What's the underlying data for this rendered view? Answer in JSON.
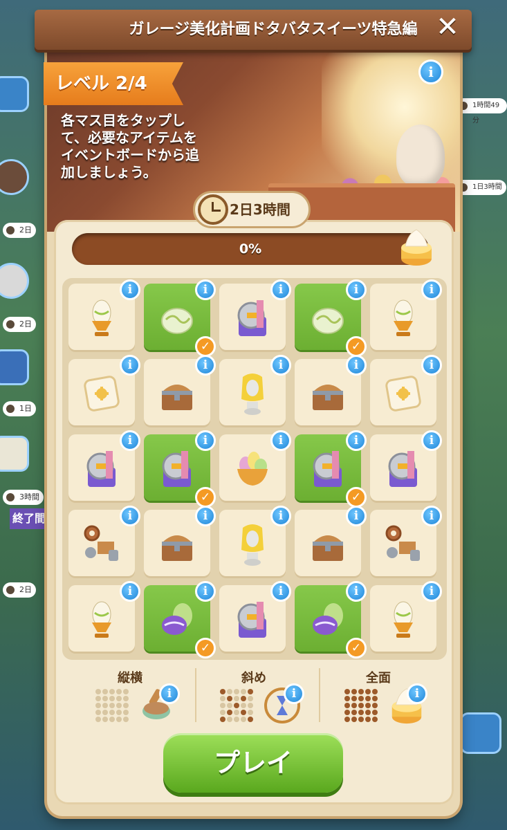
{
  "header": {
    "title": "ガレージ美化計画ドタバタスイーツ特急編",
    "close_icon": "close-icon"
  },
  "level": {
    "label": "レベル 2/4"
  },
  "instructions": "各マス目をタップし\nて、必要なアイテムを\nイベントボードから追\n加しましょう。",
  "timer": {
    "text": "2日3時間",
    "icon": "clock-icon"
  },
  "progress": {
    "text": "0%",
    "value": 0
  },
  "board": {
    "rows": [
      [
        {
          "item": "egg-cup",
          "done": false
        },
        {
          "item": "egg",
          "done": true
        },
        {
          "item": "machine",
          "done": false
        },
        {
          "item": "egg",
          "done": true
        },
        {
          "item": "egg-cup",
          "done": false
        }
      ],
      [
        {
          "item": "pillow",
          "done": false
        },
        {
          "item": "chest",
          "done": false
        },
        {
          "item": "statue",
          "done": false
        },
        {
          "item": "chest",
          "done": false
        },
        {
          "item": "pillow",
          "done": false
        }
      ],
      [
        {
          "item": "machine",
          "done": false
        },
        {
          "item": "machine",
          "done": true
        },
        {
          "item": "egg-basket",
          "done": false
        },
        {
          "item": "machine",
          "done": true
        },
        {
          "item": "machine",
          "done": false
        }
      ],
      [
        {
          "item": "gears",
          "done": false
        },
        {
          "item": "chest",
          "done": false
        },
        {
          "item": "statue",
          "done": false
        },
        {
          "item": "chest",
          "done": false
        },
        {
          "item": "gears",
          "done": false
        }
      ],
      [
        {
          "item": "egg-cup",
          "done": false
        },
        {
          "item": "purple-eggs",
          "done": true
        },
        {
          "item": "machine",
          "done": false
        },
        {
          "item": "purple-eggs",
          "done": true
        },
        {
          "item": "egg-cup",
          "done": false
        }
      ]
    ]
  },
  "patterns": [
    {
      "label": "縦横",
      "reward": "pan-icon"
    },
    {
      "label": "斜め",
      "reward": "hourglass-icon"
    },
    {
      "label": "全面",
      "reward": "cream-dessert-icon"
    }
  ],
  "play_button": "プレイ",
  "side": {
    "timers": [
      "2日",
      "2日",
      "1日",
      "3時間",
      "2日"
    ],
    "right_timers": [
      "1時間49分",
      "1日3時間"
    ],
    "badge": "終了間"
  },
  "colors": {
    "accent": "#f49a24",
    "green": "#6caf32",
    "info": "#1f86d8",
    "brown": "#7e4a2b"
  }
}
